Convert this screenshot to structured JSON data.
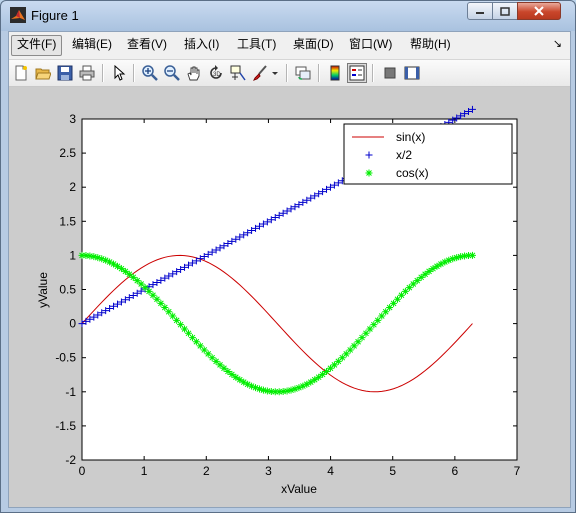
{
  "window": {
    "title": "Figure 1"
  },
  "menubar": {
    "items": [
      {
        "label": "文件(F)",
        "name": "menu-file"
      },
      {
        "label": "编辑(E)",
        "name": "menu-edit"
      },
      {
        "label": "查看(V)",
        "name": "menu-view"
      },
      {
        "label": "插入(I)",
        "name": "menu-insert"
      },
      {
        "label": "工具(T)",
        "name": "menu-tools"
      },
      {
        "label": "桌面(D)",
        "name": "menu-desktop"
      },
      {
        "label": "窗口(W)",
        "name": "menu-window"
      },
      {
        "label": "帮助(H)",
        "name": "menu-help"
      }
    ]
  },
  "toolbar": {
    "tools": [
      "new-figure-icon",
      "open-file-icon",
      "save-icon",
      "print-icon",
      "edit-plot-arrow-icon",
      "zoom-in-icon",
      "zoom-out-icon",
      "pan-hand-icon",
      "rotate-3d-icon",
      "data-cursor-icon",
      "brush-icon",
      "link-plot-icon",
      "insert-colorbar-icon",
      "insert-legend-icon",
      "hide-plot-tools-icon",
      "show-plot-tools-icon"
    ]
  },
  "chart_data": {
    "type": "line",
    "xlabel": "xValue",
    "ylabel": "yValue",
    "xlim": [
      0,
      7
    ],
    "ylim": [
      -2,
      3
    ],
    "xticks": [
      "0",
      "1",
      "2",
      "3",
      "4",
      "5",
      "6",
      "7"
    ],
    "yticks": [
      "-2",
      "-1.5",
      "-1",
      "-0.5",
      "0",
      "0.5",
      "1",
      "1.5",
      "2",
      "2.5",
      "3"
    ],
    "x_range": [
      0,
      6.2832
    ],
    "num_markers": 100,
    "legend_position": "top-right",
    "series": [
      {
        "name": "sin(x)",
        "function": "sin(x)",
        "color": "#cc0000",
        "style": "line",
        "marker": "none"
      },
      {
        "name": "x/2",
        "function": "x/2",
        "color": "#0000cc",
        "style": "none",
        "marker": "+"
      },
      {
        "name": "cos(x)",
        "function": "cos(x)",
        "color": "#00ee00",
        "style": "none",
        "marker": "*"
      }
    ]
  }
}
